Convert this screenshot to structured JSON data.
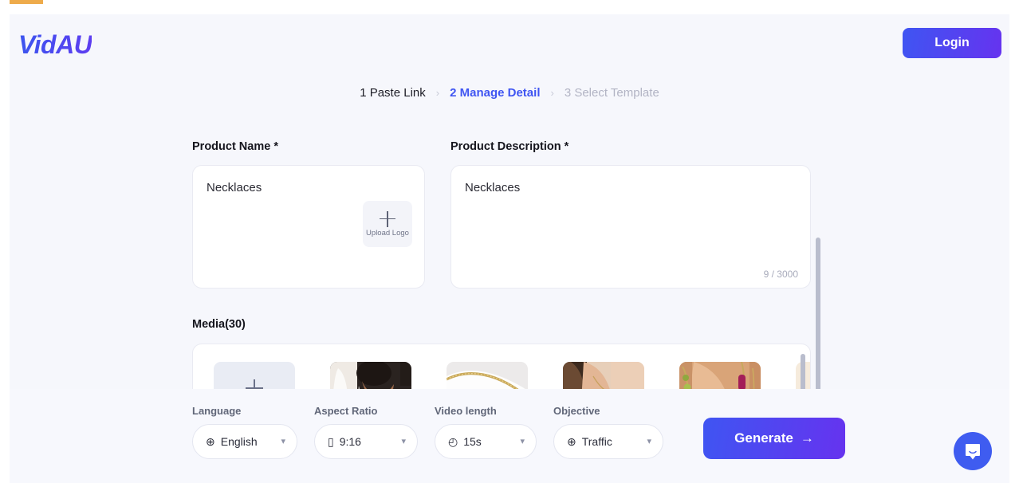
{
  "header": {
    "logo_text": "VidAU",
    "login_label": "Login"
  },
  "steps": [
    {
      "label": "1 Paste Link",
      "state": "done"
    },
    {
      "label": "2 Manage Detail",
      "state": "active"
    },
    {
      "label": "3 Select Template",
      "state": "pending"
    }
  ],
  "step_separator": "›",
  "product_name": {
    "label": "Product Name *",
    "value": "Necklaces",
    "upload_logo_label": "Upload Logo"
  },
  "product_description": {
    "label": "Product Description *",
    "value": "Necklaces",
    "counter": "9 / 3000"
  },
  "media": {
    "label": "Media(30)",
    "items": [
      {
        "name": "upload-tile",
        "type": "upload"
      },
      {
        "name": "media-thumb-1",
        "type": "image",
        "alt": "woman in white dress wearing necklace"
      },
      {
        "name": "media-thumb-2",
        "type": "image",
        "alt": "gold beaded chain on white fabric"
      },
      {
        "name": "media-thumb-3",
        "type": "image",
        "alt": "thin gold chain on neck"
      },
      {
        "name": "media-thumb-4",
        "type": "image",
        "alt": "gold layered necklace with green stones"
      },
      {
        "name": "media-thumb-5",
        "type": "image",
        "alt": "turquoise beaded necklace on cream background"
      }
    ]
  },
  "controls": [
    {
      "key": "language",
      "label": "Language",
      "icon": "globe-icon",
      "glyph": "⊕",
      "value": "English"
    },
    {
      "key": "ratio",
      "label": "Aspect Ratio",
      "icon": "phone-icon",
      "glyph": "▯",
      "value": "9:16"
    },
    {
      "key": "length",
      "label": "Video length",
      "icon": "clock-icon",
      "glyph": "◴",
      "value": "15s"
    },
    {
      "key": "objective",
      "label": "Objective",
      "icon": "target-icon",
      "glyph": "⊕",
      "value": "Traffic"
    }
  ],
  "generate": {
    "label": "Generate",
    "arrow": "→"
  },
  "colors": {
    "accent_start": "#3f55f2",
    "accent_end": "#6633ef",
    "page_bg": "#f6f7fc",
    "chat_bubble": "#3f5cf0",
    "top_strip": "#eeab4b"
  }
}
